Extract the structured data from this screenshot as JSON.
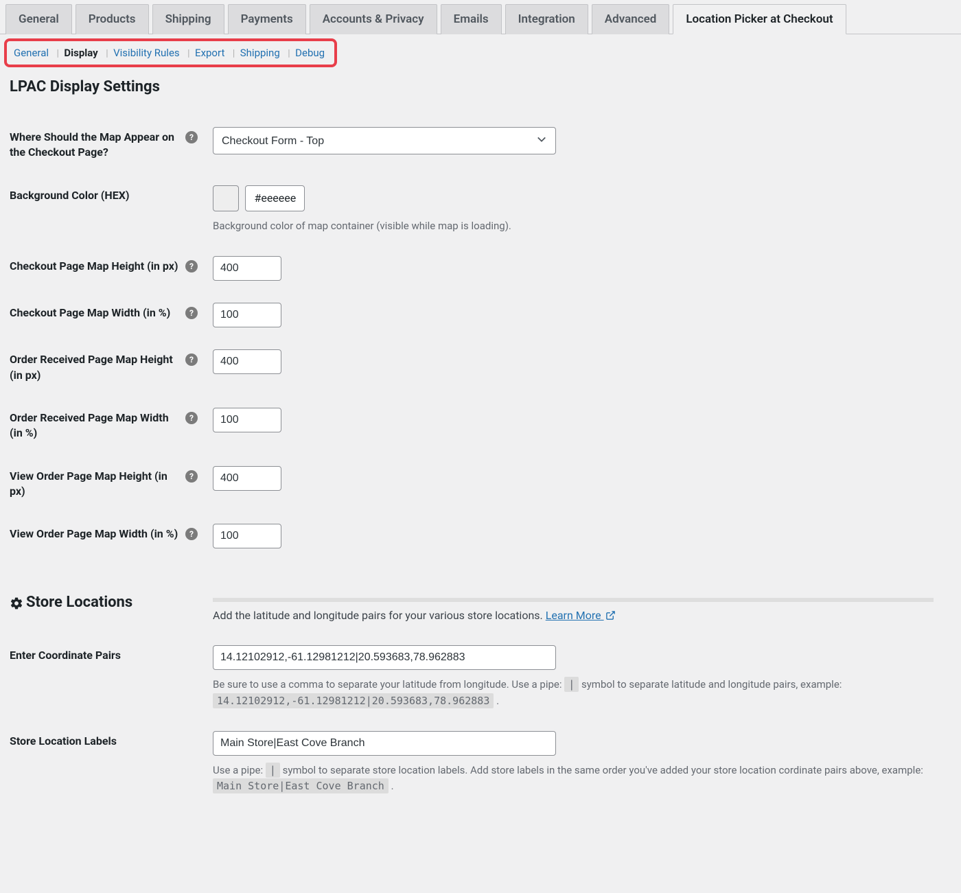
{
  "tabs": {
    "general": "General",
    "products": "Products",
    "shipping": "Shipping",
    "payments": "Payments",
    "accounts": "Accounts & Privacy",
    "emails": "Emails",
    "integration": "Integration",
    "advanced": "Advanced",
    "lpac": "Location Picker at Checkout"
  },
  "subnav": {
    "general": "General",
    "display": "Display",
    "visibility": "Visibility Rules",
    "export": "Export",
    "shipping": "Shipping",
    "debug": "Debug"
  },
  "heading": "LPAC Display Settings",
  "fields": {
    "map_appear": {
      "label": "Where Should the Map Appear on the Checkout Page?",
      "value": "Checkout Form - Top"
    },
    "bg_color": {
      "label": "Background Color (HEX)",
      "value": "#eeeeee",
      "desc": "Background color of map container (visible while map is loading)."
    },
    "checkout_height": {
      "label": "Checkout Page Map Height (in px)",
      "value": "400"
    },
    "checkout_width": {
      "label": "Checkout Page Map Width (in %)",
      "value": "100"
    },
    "order_received_height": {
      "label": "Order Received Page Map Height (in px)",
      "value": "400"
    },
    "order_received_width": {
      "label": "Order Received Page Map Width (in %)",
      "value": "100"
    },
    "view_order_height": {
      "label": "View Order Page Map Height (in px)",
      "value": "400"
    },
    "view_order_width": {
      "label": "View Order Page Map Width (in %)",
      "value": "100"
    }
  },
  "store_locations": {
    "heading": "Store Locations",
    "intro": "Add the latitude and longitude pairs for your various store locations. ",
    "learn_more": "Learn More ",
    "coord_label": "Enter Coordinate Pairs",
    "coord_value": "14.12102912,-61.12981212|20.593683,78.962883",
    "coord_desc1": "Be sure to use a comma to separate your latitude from longitude. Use a pipe: ",
    "coord_pipe": "|",
    "coord_desc2": " symbol to separate latitude and longitude pairs, example: ",
    "coord_example": "14.12102912,-61.12981212|20.593683,78.962883",
    "coord_desc3": " .",
    "labels_label": "Store Location Labels",
    "labels_value": "Main Store|East Cove Branch",
    "labels_desc1": "Use a pipe: ",
    "labels_pipe": "|",
    "labels_desc2": " symbol to separate store location labels. Add store labels in the same order you've added your store location cordinate pairs above, example: ",
    "labels_example": "Main Store|East Cove Branch",
    "labels_desc3": " ."
  }
}
